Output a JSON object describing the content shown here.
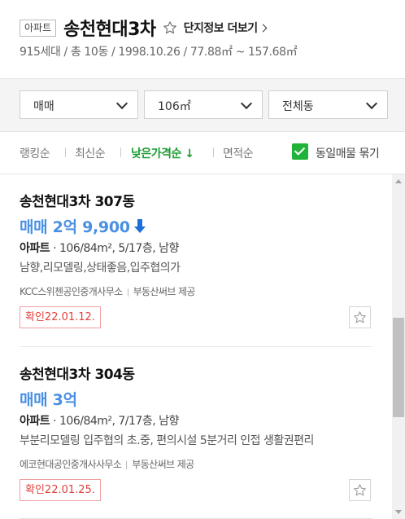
{
  "header": {
    "type_badge": "아파트",
    "complex_name": "송천현대3차",
    "detail_link": "단지정보 더보기",
    "summary": "915세대 / 총 10동 / 1998.10.26 / 77.88㎡ ~ 157.68㎡"
  },
  "filters": {
    "trade_type": "매매",
    "area": "106㎡",
    "building": "전체동"
  },
  "sort": {
    "ranking": "랭킹순",
    "latest": "최신순",
    "low_price": "낮은가격순",
    "low_price_arrow": "↓",
    "area": "면적순",
    "same_listing_label": "동일매물 묶기",
    "same_listing_checked": true
  },
  "listings": [
    {
      "title": "송천현대3차 307동",
      "price": "매매 2억 9,900",
      "price_down": true,
      "type": "아파트",
      "spec": "106/84m², 5/17층, 남향",
      "desc": "남향,리모델링,상태좋음,입주협의가",
      "agent": "KCC스위첸공인중개사무소",
      "provider": "부동산써브 제공",
      "confirmed": "확인22.01.12."
    },
    {
      "title": "송천현대3차 304동",
      "price": "매매 3억",
      "price_down": false,
      "type": "아파트",
      "spec": "106/84m², 7/17층, 남향",
      "desc": "부분리모델링 입주협의 초.중, 편의시설 5분거리 인접 생활권편리",
      "agent": "에코현대공인중개사사무소",
      "provider": "부동산써브 제공",
      "confirmed": "확인22.01.25."
    }
  ],
  "colors": {
    "accent_green": "#1a9b2f",
    "price_blue": "#4a90e2",
    "confirm_red": "#e0413c"
  }
}
